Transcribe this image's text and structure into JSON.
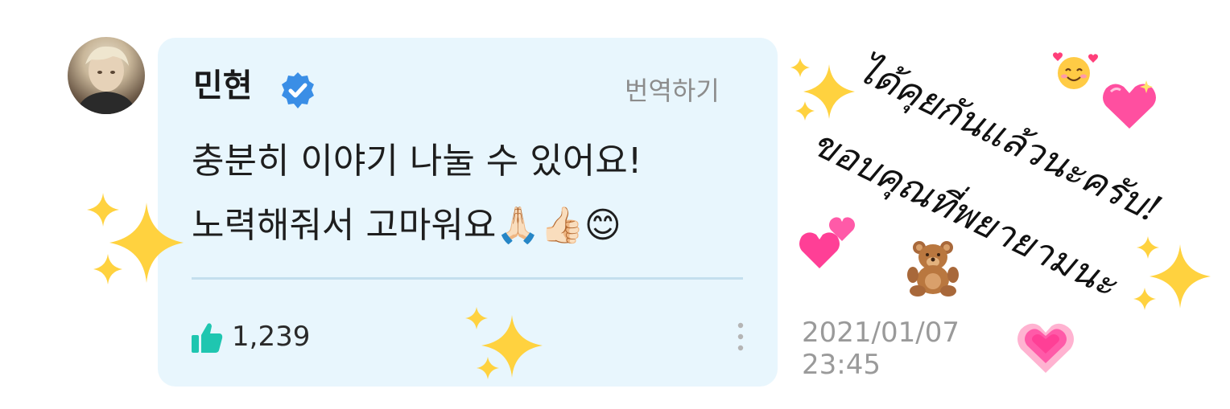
{
  "comment": {
    "author": "민현",
    "translate_label": "번역하기",
    "line1": "충분히 이야기 나눌 수 있어요!",
    "line2": "노력해줘서 고마워요🙏🏻👍🏻😊",
    "likes": "1,239",
    "date": "2021/01/07",
    "time": "23:45"
  },
  "overlay": {
    "thai_line1": "ได้คุยกันแล้วนะครับ!",
    "thai_line2": "ขอบคุณที่พยายามนะ"
  },
  "colors": {
    "card_bg": "#e8f6fd",
    "verified": "#3a8ee6",
    "like": "#1fc6b0",
    "sparkle": "#ffd23f",
    "heart": "#ff4fa0"
  },
  "icons": {
    "verified": "verified-badge-icon",
    "like": "thumbs-up-icon",
    "more": "more-vertical-icon"
  }
}
